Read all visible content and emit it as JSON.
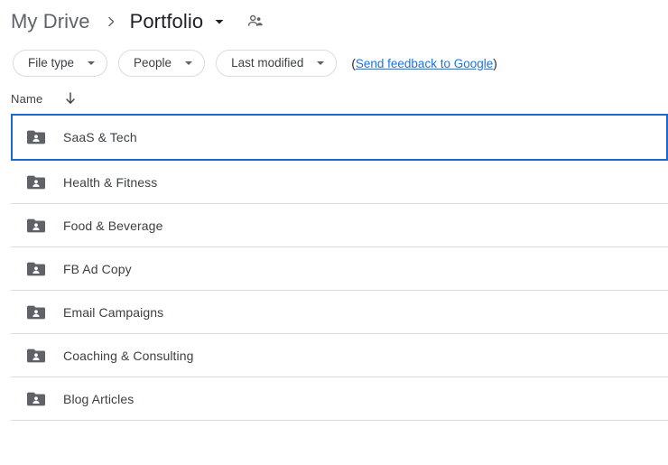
{
  "breadcrumb": {
    "root_label": "My Drive",
    "separator": "›",
    "current_label": "Portfolio",
    "caret_icon": "chevron-down-icon",
    "share_icon": "people-icon"
  },
  "filters": {
    "chips": [
      {
        "label": "File type",
        "caret_icon": "chevron-down-icon"
      },
      {
        "label": "People",
        "caret_icon": "chevron-down-icon"
      },
      {
        "label": "Last modified",
        "caret_icon": "chevron-down-icon"
      }
    ],
    "feedback": {
      "open_paren": "(",
      "link_text": "Send feedback to Google",
      "close_paren": ")"
    }
  },
  "column_header": {
    "name_label": "Name",
    "sort_icon": "arrow-down-icon"
  },
  "files": [
    {
      "name": "SaaS & Tech",
      "icon": "shared-folder-icon",
      "selected": true
    },
    {
      "name": "Health & Fitness",
      "icon": "shared-folder-icon",
      "selected": false
    },
    {
      "name": "Food & Beverage",
      "icon": "shared-folder-icon",
      "selected": false
    },
    {
      "name": "FB Ad Copy",
      "icon": "shared-folder-icon",
      "selected": false
    },
    {
      "name": "Email Campaigns",
      "icon": "shared-folder-icon",
      "selected": false
    },
    {
      "name": "Coaching & Consulting",
      "icon": "shared-folder-icon",
      "selected": false
    },
    {
      "name": "Blog Articles",
      "icon": "shared-folder-icon",
      "selected": false
    }
  ],
  "colors": {
    "accent_blue": "#1967d2",
    "link_blue": "#1a73e8",
    "divider_gray": "#dadce0",
    "text_primary": "#3c4043",
    "text_heading": "#202124",
    "icon_gray": "#5f6368"
  }
}
